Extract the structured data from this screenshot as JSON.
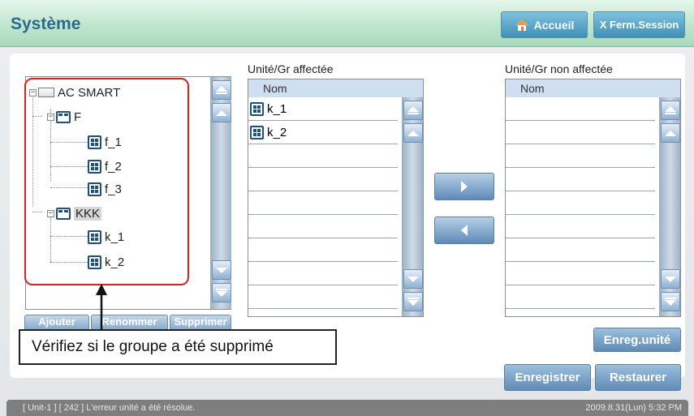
{
  "header": {
    "title": "Système",
    "home_label": "Accueil",
    "logout_label": "X Ferm.Session",
    "colors": {
      "header_top": "#e6f6ec",
      "header_bottom": "#a9d9bb",
      "title": "#2a6b8e",
      "button": "#3f8fb8"
    }
  },
  "tree": {
    "root": "AC SMART",
    "groups": [
      {
        "name": "F",
        "units": [
          "f_1",
          "f_2",
          "f_3"
        ]
      },
      {
        "name": "KKK",
        "units": [
          "k_1",
          "k_2"
        ],
        "selected": true
      }
    ]
  },
  "assigned": {
    "title": "Unité/Gr affectée",
    "column": "Nom",
    "items": [
      "k_1",
      "k_2"
    ]
  },
  "unassigned": {
    "title": "Unité/Gr non affectée",
    "column": "Nom",
    "items": []
  },
  "tree_buttons": {
    "add": "Ajouter",
    "rename": "Renommer",
    "delete": "Supprimer"
  },
  "buttons": {
    "save_unit": "Enreg.unité",
    "save": "Enregistrer",
    "restore": "Restaurer"
  },
  "annotation": {
    "text": "Vérifiez si le groupe a été supprimé",
    "color": "#e0201a"
  },
  "status": {
    "message": "[ Unit-1 ] [ 242 ] L'erreur unité a été résolue.",
    "datetime": "2009.8.31(Lun)  5:32 PM"
  },
  "icons": {
    "home": "home-icon",
    "move_right": "arrow-right-icon",
    "move_left": "arrow-left-icon"
  }
}
